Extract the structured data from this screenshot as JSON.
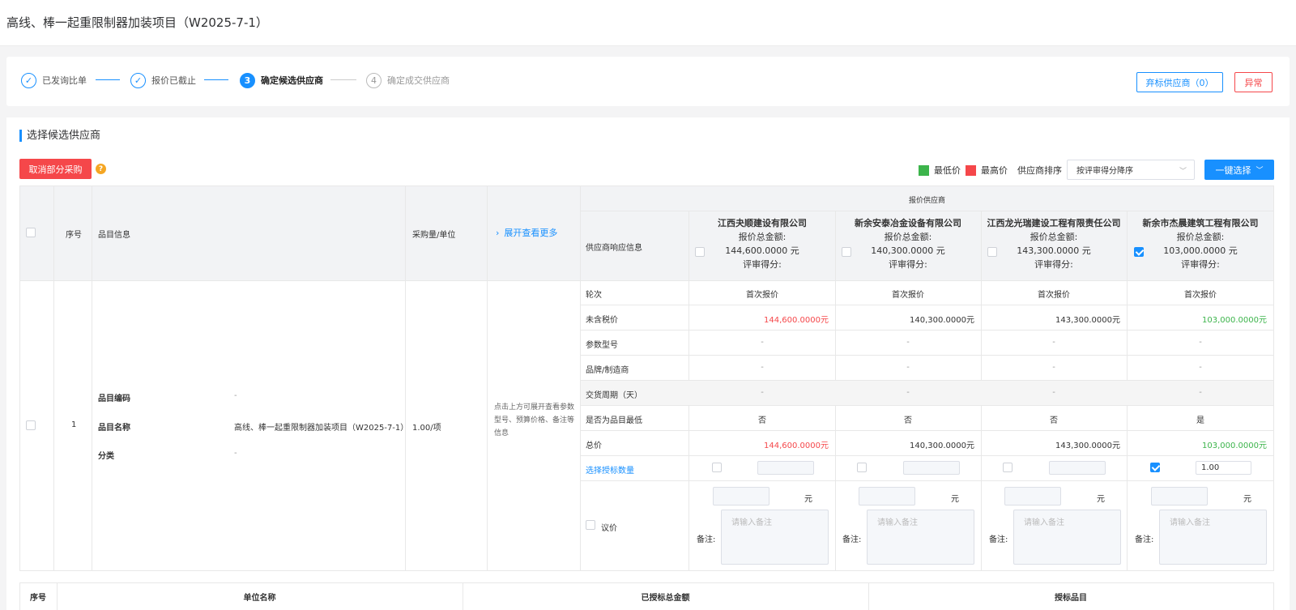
{
  "page": {
    "title": "高线、棒一起重限制器加装项目（W2025-7-1）"
  },
  "steps": [
    {
      "num": "✓",
      "label": "已发询比单"
    },
    {
      "num": "✓",
      "label": "报价已截止"
    },
    {
      "num": "3",
      "label": "确定候选供应商"
    },
    {
      "num": "4",
      "label": "确定成交供应商"
    }
  ],
  "top_buttons": {
    "abandon": "弃标供应商（0）",
    "exception": "异常"
  },
  "section": {
    "title": "选择候选供应商"
  },
  "toolbar": {
    "cancel_partial": "取消部分采购",
    "help": "?",
    "legend_low": "最低价",
    "legend_high": "最高价",
    "sort_label": "供应商排序",
    "sort_value": "按评审得分降序",
    "one_click": "一键选择"
  },
  "colors": {
    "primary": "#1890ff",
    "low": "#3cb44b",
    "high": "#f5474a"
  },
  "table": {
    "headers": {
      "seq": "序号",
      "item_info": "品目信息",
      "qty": "采购量/单位",
      "expand": "展开查看更多",
      "group": "报价供应商",
      "resp": "供应商响应信息"
    },
    "suppliers": [
      {
        "name": "江西夬顺建设有限公司",
        "total_label": "报价总金额:",
        "total": "144,600.0000 元",
        "score_label": "评审得分:",
        "round": "首次报价",
        "untaxed": "144,600.0000元",
        "param": "-",
        "brand": "-",
        "period": "-",
        "lowest": "否",
        "price": "144,600.0000元",
        "qty": "",
        "checked": false
      },
      {
        "name": "新余安泰冶金设备有限公司",
        "total_label": "报价总金额:",
        "total": "140,300.0000 元",
        "score_label": "评审得分:",
        "round": "首次报价",
        "untaxed": "140,300.0000元",
        "param": "-",
        "brand": "-",
        "period": "-",
        "lowest": "否",
        "price": "140,300.0000元",
        "qty": "",
        "checked": false
      },
      {
        "name": "江西龙光瑞建设工程有限责任公司",
        "total_label": "报价总金额:",
        "total": "143,300.0000 元",
        "score_label": "评审得分:",
        "round": "首次报价",
        "untaxed": "143,300.0000元",
        "param": "-",
        "brand": "-",
        "period": "-",
        "lowest": "否",
        "price": "143,300.0000元",
        "qty": "",
        "checked": false
      },
      {
        "name": "新余市杰晨建筑工程有限公司",
        "total_label": "报价总金额:",
        "total": "103,000.0000 元",
        "score_label": "评审得分:",
        "round": "首次报价",
        "untaxed": "103,000.0000元",
        "param": "-",
        "brand": "-",
        "period": "-",
        "lowest": "是",
        "price": "103,000.0000元",
        "qty": "1.00",
        "checked": true
      }
    ],
    "row_labels": [
      "轮次",
      "未含税价",
      "参数型号",
      "品牌/制造商",
      "交货周期（天）",
      "是否为品目最低",
      "总价",
      "选择授标数量",
      "议价"
    ],
    "row": {
      "seq": "1",
      "code_label": "品目编码",
      "code_value": "-",
      "name_label": "品目名称",
      "name_value": "高线、棒一起重限制器加装项目（W2025-7-1）",
      "cat_label": "分类",
      "cat_value": "-",
      "qty": "1.00/项",
      "expand_hint": "点击上方可展开查看参数型号、预算价格、备注等信息"
    },
    "yuan": "元",
    "remark_label": "备注:",
    "remark_placeholder": "请输入备注"
  },
  "bottom_table": {
    "headers": [
      "序号",
      "单位名称",
      "已授标总金额",
      "授标品目"
    ]
  }
}
